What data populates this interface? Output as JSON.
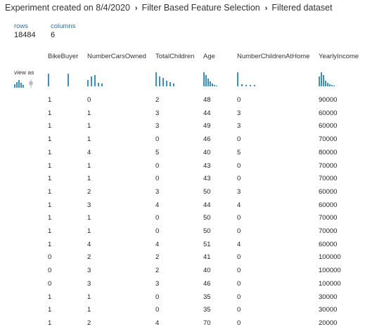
{
  "breadcrumb": {
    "experiment": "Experiment created on 8/4/2020",
    "module": "Filter Based Feature Selection",
    "output": "Filtered dataset"
  },
  "stats": {
    "rows_label": "rows",
    "rows_value": "18484",
    "columns_label": "columns",
    "columns_value": "6"
  },
  "view_as": {
    "label": "view as",
    "icons": [
      "histogram-icon",
      "boxplot-icon"
    ]
  },
  "accent_color": "#3a8fc4",
  "table": {
    "columns": [
      "BikeBuyer",
      "NumberCarsOwned",
      "TotalChildren",
      "Age",
      "NumberChildrenAtHome",
      "YearlyIncome"
    ],
    "rows": [
      [
        "1",
        "0",
        "2",
        "48",
        "0",
        "90000"
      ],
      [
        "1",
        "1",
        "3",
        "44",
        "3",
        "60000"
      ],
      [
        "1",
        "1",
        "3",
        "49",
        "3",
        "60000"
      ],
      [
        "1",
        "1",
        "0",
        "46",
        "0",
        "70000"
      ],
      [
        "1",
        "4",
        "5",
        "40",
        "5",
        "80000"
      ],
      [
        "1",
        "1",
        "0",
        "43",
        "0",
        "70000"
      ],
      [
        "1",
        "1",
        "0",
        "43",
        "0",
        "70000"
      ],
      [
        "1",
        "2",
        "3",
        "50",
        "3",
        "60000"
      ],
      [
        "1",
        "3",
        "4",
        "44",
        "4",
        "60000"
      ],
      [
        "1",
        "1",
        "0",
        "50",
        "0",
        "70000"
      ],
      [
        "1",
        "1",
        "0",
        "50",
        "0",
        "70000"
      ],
      [
        "1",
        "4",
        "4",
        "51",
        "4",
        "60000"
      ],
      [
        "0",
        "2",
        "2",
        "41",
        "0",
        "100000"
      ],
      [
        "0",
        "3",
        "2",
        "40",
        "0",
        "100000"
      ],
      [
        "0",
        "3",
        "3",
        "46",
        "0",
        "100000"
      ],
      [
        "1",
        "1",
        "0",
        "35",
        "0",
        "30000"
      ],
      [
        "1",
        "1",
        "0",
        "35",
        "0",
        "30000"
      ],
      [
        "1",
        "2",
        "4",
        "70",
        "0",
        "20000"
      ]
    ]
  }
}
